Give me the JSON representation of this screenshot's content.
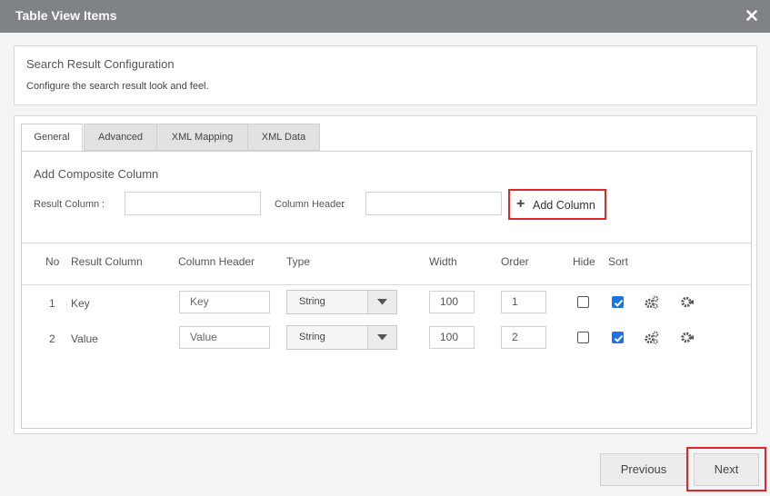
{
  "dialog": {
    "title": "Table View Items"
  },
  "config": {
    "heading": "Search Result Configuration",
    "description": "Configure the search result look and feel."
  },
  "tabs": [
    {
      "label": "General",
      "active": true
    },
    {
      "label": "Advanced",
      "active": false
    },
    {
      "label": "XML Mapping",
      "active": false
    },
    {
      "label": "XML Data",
      "active": false
    }
  ],
  "composite": {
    "title": "Add Composite Column",
    "result_column_label": "Result Column",
    "result_column_value": "",
    "column_header_label": "Column Header",
    "column_header_value": "",
    "separator": ":",
    "add_button": "Add Column"
  },
  "table": {
    "headers": {
      "no": "No",
      "result_column": "Result Column",
      "column_header": "Column Header",
      "type": "Type",
      "width": "Width",
      "order": "Order",
      "hide": "Hide",
      "sort": "Sort"
    },
    "rows": [
      {
        "no": "1",
        "result_column": "Key",
        "column_header": "Key",
        "type": "String",
        "width": "100",
        "order": "1",
        "hide": false,
        "sort": true
      },
      {
        "no": "2",
        "result_column": "Value",
        "column_header": "Value",
        "type": "String",
        "width": "100",
        "order": "2",
        "hide": false,
        "sort": true
      }
    ]
  },
  "footer": {
    "previous": "Previous",
    "next": "Next"
  },
  "colors": {
    "titlebar": "#7f8287",
    "highlight": "#e0262b",
    "checkbox": "#1a73e8"
  },
  "icons": [
    "close-icon",
    "plus-icon",
    "chevron-down-icon",
    "gears-icon",
    "settings-icon"
  ]
}
